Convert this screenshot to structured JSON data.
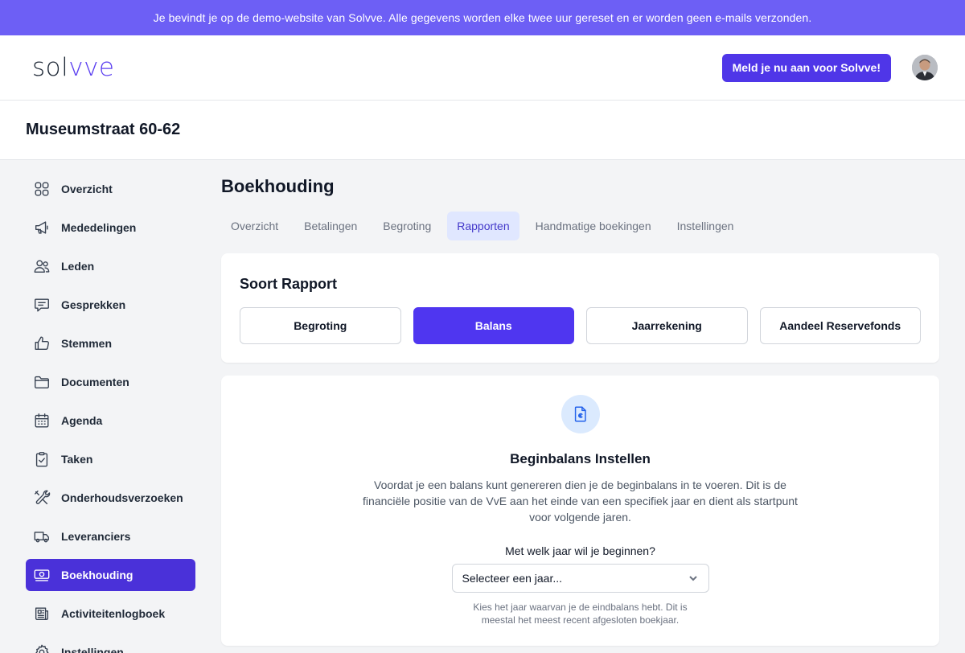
{
  "banner": {
    "text": "Je bevindt je op de demo-website van Solvve. Alle gegevens worden elke twee uur gereset en er worden geen e-mails verzonden."
  },
  "header": {
    "logo_part1": "sol",
    "logo_part2": "vve",
    "signup_label": "Meld je nu aan voor Solvve!",
    "brand_color": "#4f36e8"
  },
  "property": {
    "title": "Museumstraat 60-62"
  },
  "sidebar": {
    "items": [
      {
        "label": "Overzicht",
        "icon": "grid-icon"
      },
      {
        "label": "Mededelingen",
        "icon": "megaphone-icon"
      },
      {
        "label": "Leden",
        "icon": "users-icon"
      },
      {
        "label": "Gesprekken",
        "icon": "chat-icon"
      },
      {
        "label": "Stemmen",
        "icon": "thumbs-up-icon"
      },
      {
        "label": "Documenten",
        "icon": "folder-icon"
      },
      {
        "label": "Agenda",
        "icon": "calendar-icon"
      },
      {
        "label": "Taken",
        "icon": "clipboard-check-icon"
      },
      {
        "label": "Onderhoudsverzoeken",
        "icon": "tools-icon"
      },
      {
        "label": "Leveranciers",
        "icon": "truck-icon"
      },
      {
        "label": "Boekhouding",
        "icon": "cash-icon",
        "active": true
      },
      {
        "label": "Activiteitenlogboek",
        "icon": "newspaper-icon"
      },
      {
        "label": "Instellingen",
        "icon": "gear-icon"
      }
    ]
  },
  "main": {
    "title": "Boekhouding",
    "tabs": [
      {
        "label": "Overzicht"
      },
      {
        "label": "Betalingen"
      },
      {
        "label": "Begroting"
      },
      {
        "label": "Rapporten",
        "active": true
      },
      {
        "label": "Handmatige boekingen"
      },
      {
        "label": "Instellingen"
      }
    ]
  },
  "report": {
    "heading": "Soort Rapport",
    "buttons": [
      {
        "label": "Begroting"
      },
      {
        "label": "Balans",
        "active": true
      },
      {
        "label": "Jaarrekening"
      },
      {
        "label": "Aandeel Reservefonds"
      }
    ]
  },
  "balance": {
    "icon": "document-euro-icon",
    "title": "Beginbalans Instellen",
    "description": "Voordat je een balans kunt genereren dien je de beginbalans in te voeren. Dit is de financiële positie van de VvE aan het einde van een specifiek jaar en dient als startpunt voor volgende jaren.",
    "year_question": "Met welk jaar wil je beginnen?",
    "year_select_value": "Selecteer een jaar...",
    "year_hint": "Kies het jaar waarvan je de eindbalans hebt. Dit is meestal het meest recent afgesloten boekjaar."
  }
}
